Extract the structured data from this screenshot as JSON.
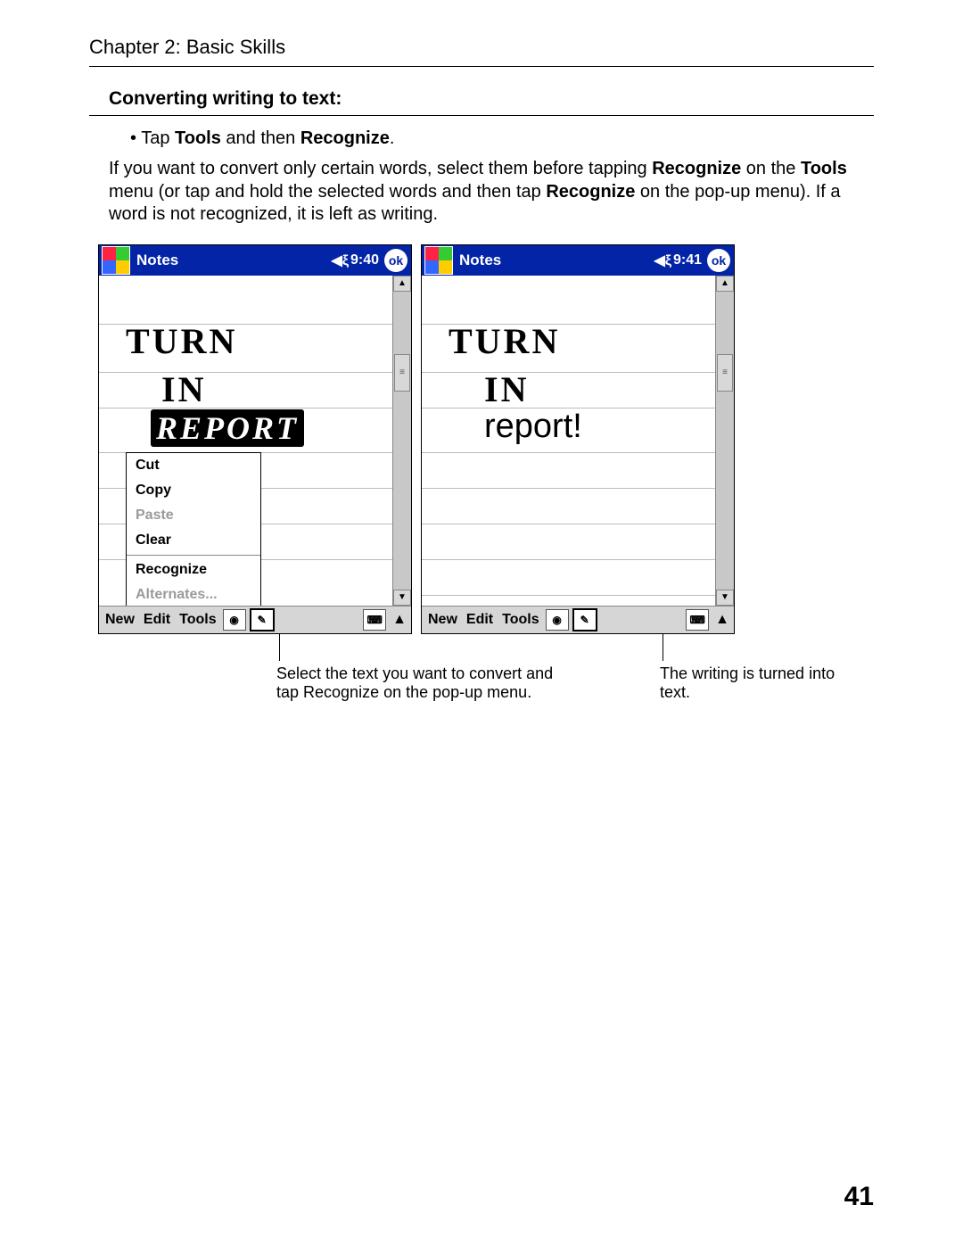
{
  "header": {
    "chapter": "Chapter 2: Basic Skills"
  },
  "section": {
    "title": "Converting writing to text:"
  },
  "bullet": {
    "pre": "Tap ",
    "b1": "Tools",
    "mid": " and then ",
    "b2": "Recognize",
    "post": "."
  },
  "para": {
    "p1": "If you want to convert only certain words, select them before tapping ",
    "b1": "Recognize",
    "p2": " on the ",
    "b2": "Tools",
    "p3": " menu (or tap and hold the selected words and then tap ",
    "b3": "Recognize",
    "p4": " on the pop-up menu). If a word is not recognized, it is left as writing."
  },
  "screens": {
    "left": {
      "title": "Notes",
      "time": "9:40",
      "ok": "ok",
      "hw1": "TURN",
      "hw2": "IN",
      "hw3": "REPORT",
      "menu": {
        "cut": "Cut",
        "copy": "Copy",
        "paste": "Paste",
        "clear": "Clear",
        "recognize": "Recognize",
        "alternates": "Alternates..."
      },
      "bottom": {
        "new": "New",
        "edit": "Edit",
        "tools": "Tools"
      }
    },
    "right": {
      "title": "Notes",
      "time": "9:41",
      "ok": "ok",
      "hw1": "TURN",
      "hw2": "IN",
      "converted": "report!",
      "bottom": {
        "new": "New",
        "edit": "Edit",
        "tools": "Tools"
      }
    }
  },
  "callouts": {
    "left": "Select the text you want to convert and tap Recognize on the pop-up menu.",
    "right": "The writing is turned into text."
  },
  "page_number": "41"
}
